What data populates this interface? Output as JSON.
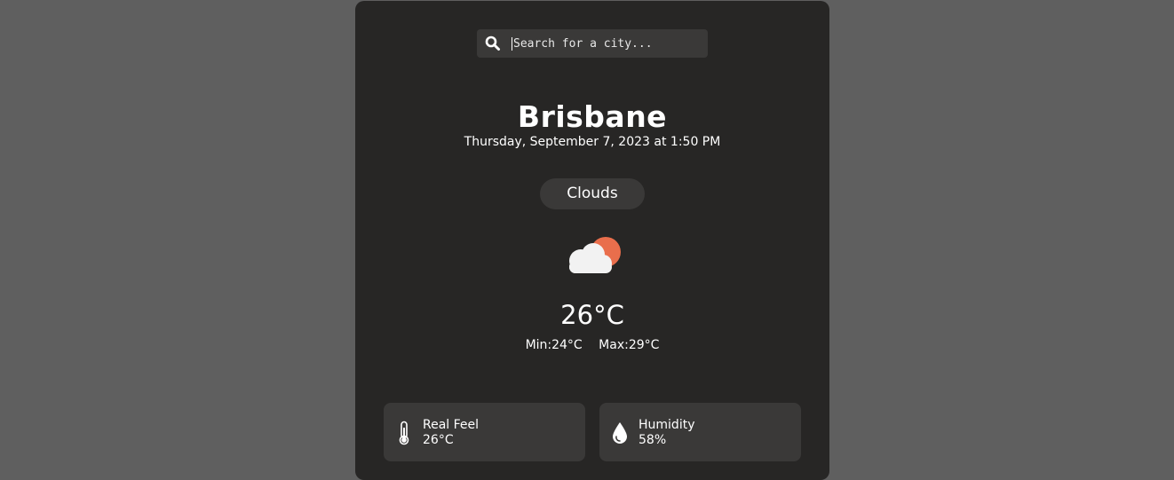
{
  "search": {
    "placeholder": "Search for a city...",
    "icon": "search-icon"
  },
  "location": {
    "city": "Brisbane",
    "datetime": "Thursday, September 7, 2023 at 1:50 PM"
  },
  "weather": {
    "condition": "Clouds",
    "icon": "cloud-sun-icon",
    "temperature": "26°C",
    "min": "Min:24°C",
    "max": "Max:29°C"
  },
  "stats": [
    {
      "label": "Real Feel",
      "value": "26°C",
      "icon": "thermometer-icon"
    },
    {
      "label": "Humidity",
      "value": "58%",
      "icon": "water-drop-icon"
    }
  ],
  "colors": {
    "background": "#5f5f5f",
    "card": "#272625",
    "panel": "#3a3938",
    "sun": "#e96e4c",
    "cloud": "#f2f2f2"
  }
}
